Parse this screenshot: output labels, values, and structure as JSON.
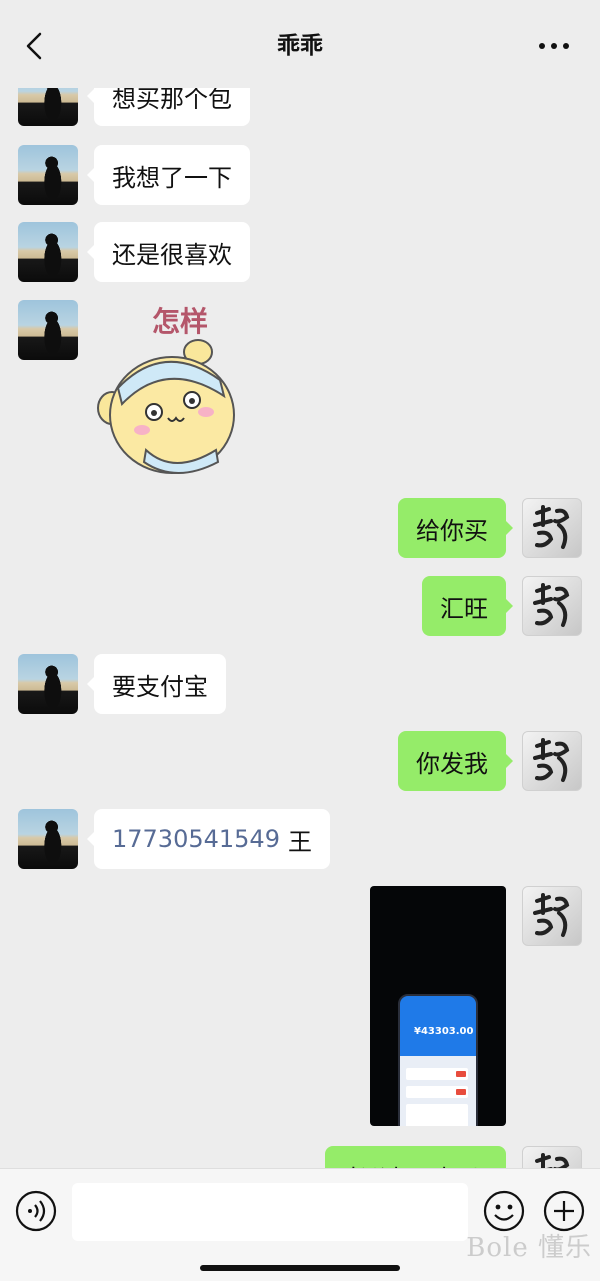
{
  "header": {
    "title": "乖乖"
  },
  "messages": {
    "m1": "想买那个包",
    "m2": "我想了一下",
    "m3": "还是很喜欢",
    "sticker_text": "怎样",
    "m5": "给你买",
    "m6": "汇旺",
    "m7": "要支付宝",
    "m8": "你发我",
    "m9_phone": "17730541549",
    "m9_name": "王",
    "m10_partial": "老公好不好😊",
    "photo_amount": "¥43303.00"
  },
  "footer": {
    "watermark": "Bole 懂乐"
  },
  "colors": {
    "outgoing_bubble": "#95ec69",
    "incoming_bubble": "#ffffff",
    "link": "#576b95"
  }
}
